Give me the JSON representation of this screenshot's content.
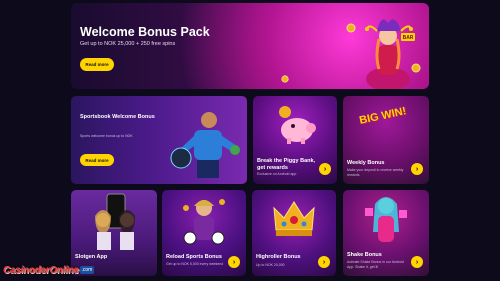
{
  "hero": {
    "title": "Welcome Bonus Pack",
    "subtitle": "Get up to NOK 25,000 + 250 free spins",
    "button": "Read more",
    "sign": "BAR"
  },
  "cards": [
    {
      "title": "Sportsbook Welcome Bonus",
      "subtitle": "Sports welcome bonus up to NOK",
      "button": "Read more"
    },
    {
      "title": "Break the Piggy Bank, get rewards",
      "subtitle": "Exclusive on Android app"
    },
    {
      "title": "Weekly Bonus",
      "subtitle": "Make your deposit to receive weekly rewards",
      "banner": "BIG WIN!"
    },
    {
      "title": "Slotgen App"
    },
    {
      "title": "Reload Sports Bonus",
      "subtitle": "Get up to NOK 5,000 every weekend"
    },
    {
      "title": "Highroller Bonus",
      "subtitle": "Up to NOK 20,000"
    },
    {
      "title": "Shake Bonus",
      "subtitle": "Activate Shake Bonus in our Android App. Shake it, get it!"
    }
  ],
  "arrow_glyph": "›",
  "watermark": {
    "name": "CasinoderOnline",
    "suffix": ".com"
  },
  "colors": {
    "accent": "#ffd400",
    "background": "#0d0a1c"
  }
}
